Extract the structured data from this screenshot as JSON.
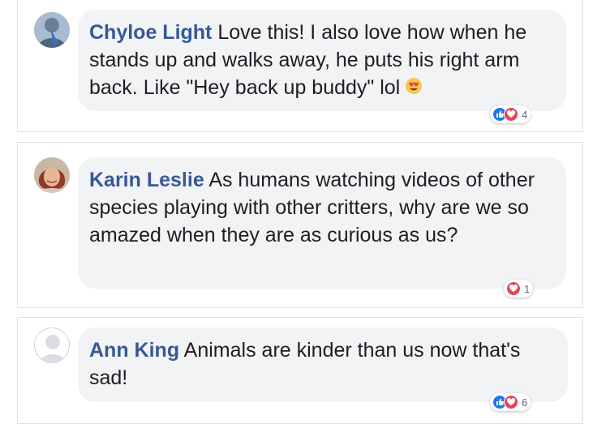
{
  "colors": {
    "author": "#385898",
    "bubble": "#f2f3f5",
    "like": "#1877f2",
    "love": "#e4465b"
  },
  "comments": [
    {
      "author": "Chyloe Light",
      "text": "Love this! I also love how when he stands up and walks away, he puts his right arm back. Like \"Hey back up buddy\" lol",
      "emoji": "heart-eyes-emoji-icon",
      "reactions": [
        "like",
        "love"
      ],
      "reaction_count": "4"
    },
    {
      "author": "Karin Leslie",
      "text": "As humans watching videos of other species playing with other critters, why are we so amazed when they are as curious as us?",
      "reactions": [
        "love"
      ],
      "reaction_count": "1"
    },
    {
      "author": "Ann King",
      "text": "Animals are kinder than us now that's sad!",
      "reactions": [
        "like",
        "love"
      ],
      "reaction_count": "6"
    }
  ]
}
